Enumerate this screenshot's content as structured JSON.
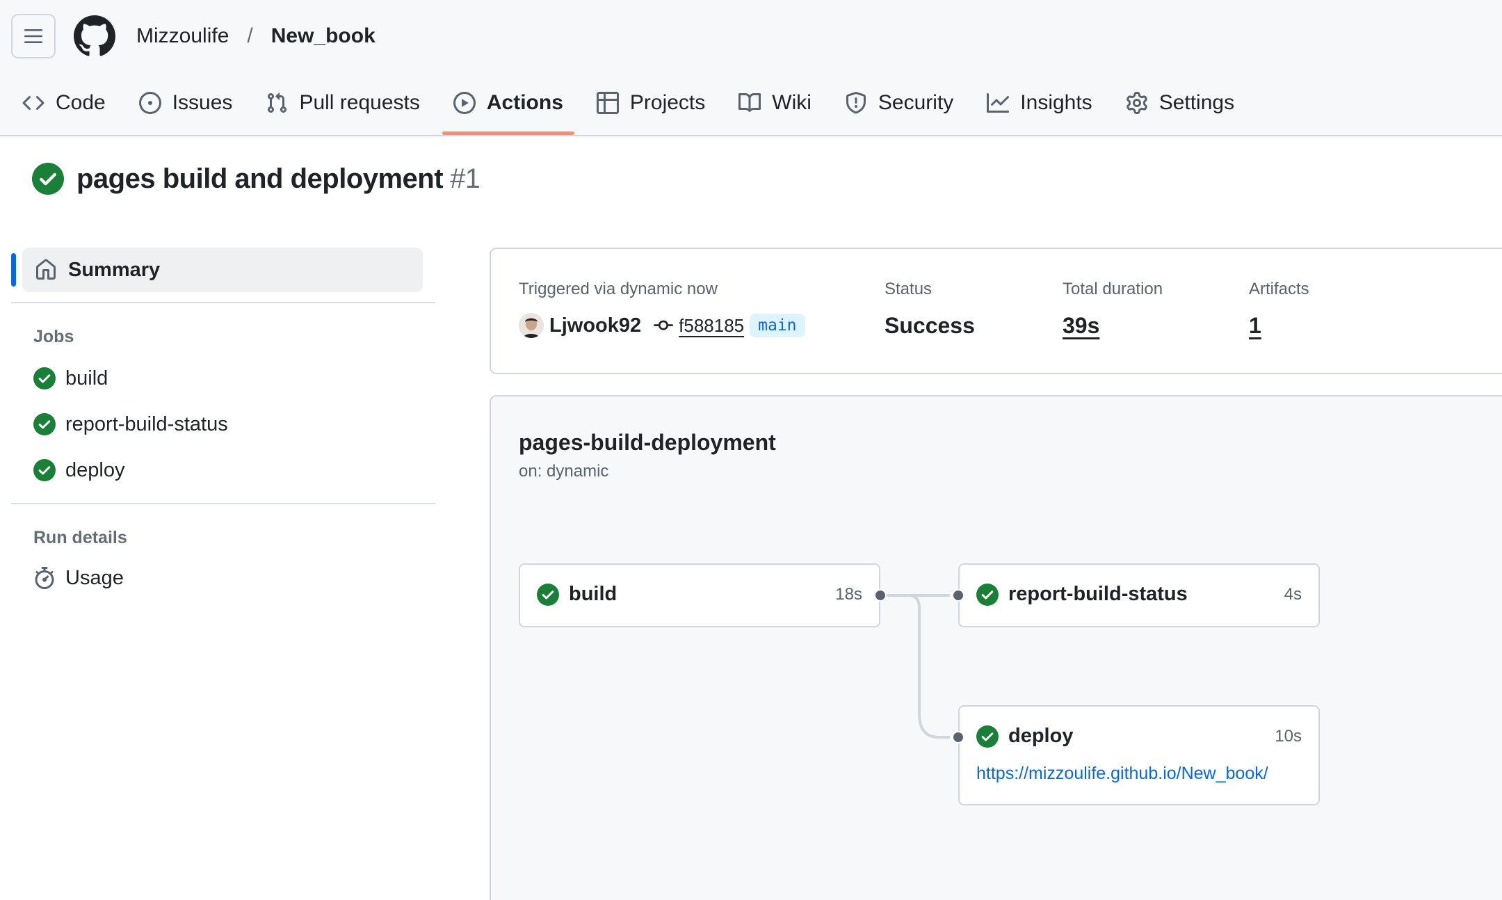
{
  "header": {
    "owner": "Mizzoulife",
    "separator": "/",
    "repo": "New_book"
  },
  "tabs": [
    {
      "label": "Code",
      "icon": "code-icon"
    },
    {
      "label": "Issues",
      "icon": "issue-opened-icon"
    },
    {
      "label": "Pull requests",
      "icon": "git-pull-request-icon"
    },
    {
      "label": "Actions",
      "icon": "play-icon",
      "active": true
    },
    {
      "label": "Projects",
      "icon": "table-icon"
    },
    {
      "label": "Wiki",
      "icon": "book-icon"
    },
    {
      "label": "Security",
      "icon": "shield-icon"
    },
    {
      "label": "Insights",
      "icon": "graph-icon"
    },
    {
      "label": "Settings",
      "icon": "gear-icon"
    }
  ],
  "run": {
    "title": "pages build and deployment",
    "number": "#1",
    "status_color": "#1a7f37"
  },
  "sidebar": {
    "summary_label": "Summary",
    "jobs_heading": "Jobs",
    "jobs": [
      "build",
      "report-build-status",
      "deploy"
    ],
    "run_details_heading": "Run details",
    "usage_label": "Usage"
  },
  "summary": {
    "trigger_label": "Triggered via dynamic now",
    "actor": "Ljwook92",
    "commit_sha": "f588185",
    "branch": "main",
    "status_label": "Status",
    "status_value": "Success",
    "duration_label": "Total duration",
    "duration_value": "39s",
    "artifacts_label": "Artifacts",
    "artifacts_value": "1"
  },
  "workflow": {
    "name": "pages-build-deployment",
    "trigger": "on: dynamic",
    "jobs": {
      "build": {
        "name": "build",
        "duration": "18s"
      },
      "report": {
        "name": "report-build-status",
        "duration": "4s"
      },
      "deploy": {
        "name": "deploy",
        "duration": "10s",
        "url": "https://mizzoulife.github.io/New_book/"
      }
    }
  },
  "colors": {
    "accent": "#0969da",
    "success": "#1a7f37",
    "tab_underline": "#fd8c73"
  }
}
